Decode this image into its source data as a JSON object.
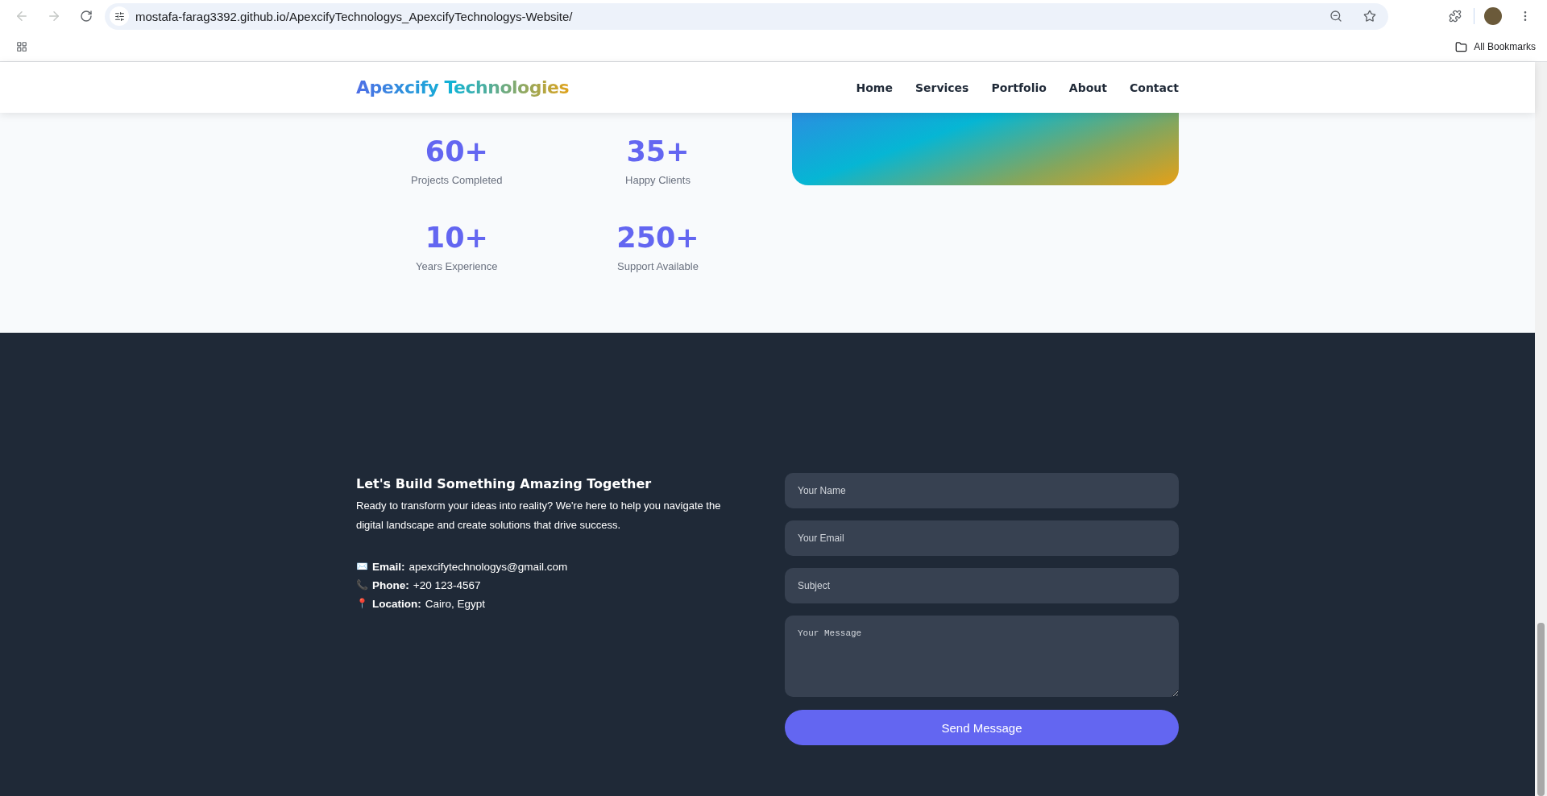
{
  "browser": {
    "url": "mostafa-farag3392.github.io/ApexcifyTechnologys_ApexcifyTechnologys-Website/",
    "bookmarks_label": "All Bookmarks"
  },
  "header": {
    "logo": "Apexcify Technologies",
    "nav": [
      {
        "label": "Home"
      },
      {
        "label": "Services"
      },
      {
        "label": "Portfolio"
      },
      {
        "label": "About"
      },
      {
        "label": "Contact"
      }
    ]
  },
  "stats": [
    {
      "value": "60+",
      "label": "Projects Completed"
    },
    {
      "value": "35+",
      "label": "Happy Clients"
    },
    {
      "value": "10+",
      "label": "Years Experience"
    },
    {
      "value": "250+",
      "label": "Support Available"
    }
  ],
  "contact": {
    "title": "Let's Build Something Amazing Together",
    "text": "Ready to transform your ideas into reality? We're here to help you navigate the digital landscape and create solutions that drive success.",
    "info": [
      {
        "icon": "✉️",
        "label": "Email:",
        "value": "apexcifytechnologys@gmail.com"
      },
      {
        "icon": "📞",
        "label": "Phone:",
        "value": "+20 123-4567"
      },
      {
        "icon": "📍",
        "label": "Location:",
        "value": "Cairo, Egypt"
      }
    ],
    "form": {
      "fields": [
        {
          "kind": "input",
          "placeholder": "Your Name"
        },
        {
          "kind": "input",
          "placeholder": "Your Email"
        },
        {
          "kind": "input",
          "placeholder": "Subject"
        },
        {
          "kind": "textarea",
          "placeholder": "Your Message"
        }
      ],
      "submit": "Send Message"
    }
  }
}
